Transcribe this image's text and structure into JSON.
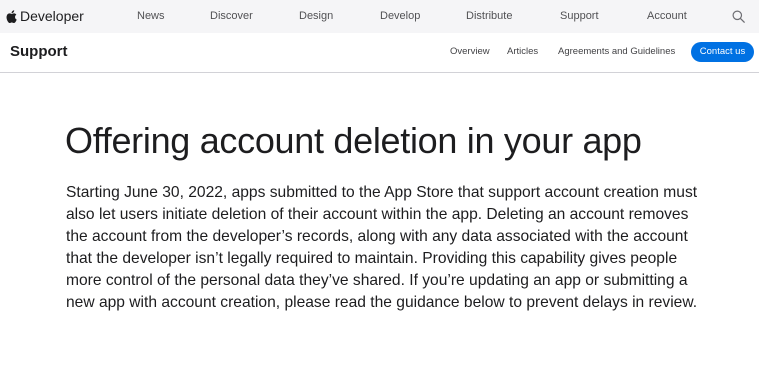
{
  "global_nav": {
    "brand": "Developer",
    "links": [
      "News",
      "Discover",
      "Design",
      "Develop",
      "Distribute",
      "Support",
      "Account"
    ]
  },
  "local_nav": {
    "title": "Support",
    "links": [
      "Overview",
      "Articles",
      "Agreements and Guidelines"
    ],
    "cta": "Contact us"
  },
  "article": {
    "title": "Offering account deletion in your app",
    "body": "Starting June 30, 2022, apps submitted to the App Store that support account creation must also let users initiate deletion of their account within the app. Deleting an account removes the account from the developer’s records, along with any data associated with the account that the developer isn’t legally required to maintain. Providing this capability gives people more control of the personal data they’ve shared. If you’re updating an app or submitting a new app with account creation, please read the guidance below to prevent delays in review."
  },
  "colors": {
    "accent": "#0071e3",
    "nav_background": "#f5f5f7",
    "text": "#1d1d1f"
  }
}
